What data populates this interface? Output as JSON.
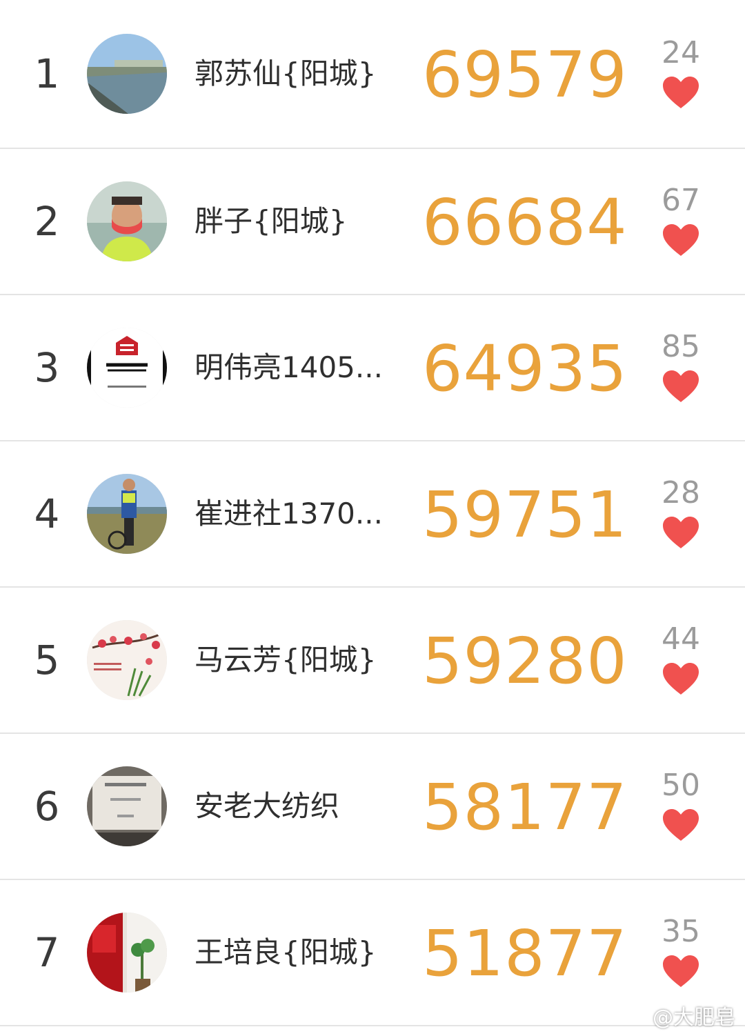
{
  "colors": {
    "score": "#e9a23b",
    "heart": "#f0514f",
    "rank_text": "#3a3a3a",
    "like_count": "#9b9b9b"
  },
  "rows": [
    {
      "rank": "1",
      "name": "郭苏仙{阳城}",
      "score": "69579",
      "likes": "24",
      "icon": "heart-icon"
    },
    {
      "rank": "2",
      "name": "胖子{阳城}",
      "score": "66684",
      "likes": "67",
      "icon": "heart-icon"
    },
    {
      "rank": "3",
      "name": "明伟亮1405...",
      "score": "64935",
      "likes": "85",
      "icon": "heart-icon"
    },
    {
      "rank": "4",
      "name": "崔进社1370...",
      "score": "59751",
      "likes": "28",
      "icon": "heart-icon"
    },
    {
      "rank": "5",
      "name": "马云芳{阳城}",
      "score": "59280",
      "likes": "44",
      "icon": "heart-icon"
    },
    {
      "rank": "6",
      "name": "安老大纺织",
      "score": "58177",
      "likes": "50",
      "icon": "heart-icon"
    },
    {
      "rank": "7",
      "name": "王培良{阳城}",
      "score": "51877",
      "likes": "35",
      "icon": "heart-icon"
    }
  ],
  "watermark": "@大肥皂"
}
